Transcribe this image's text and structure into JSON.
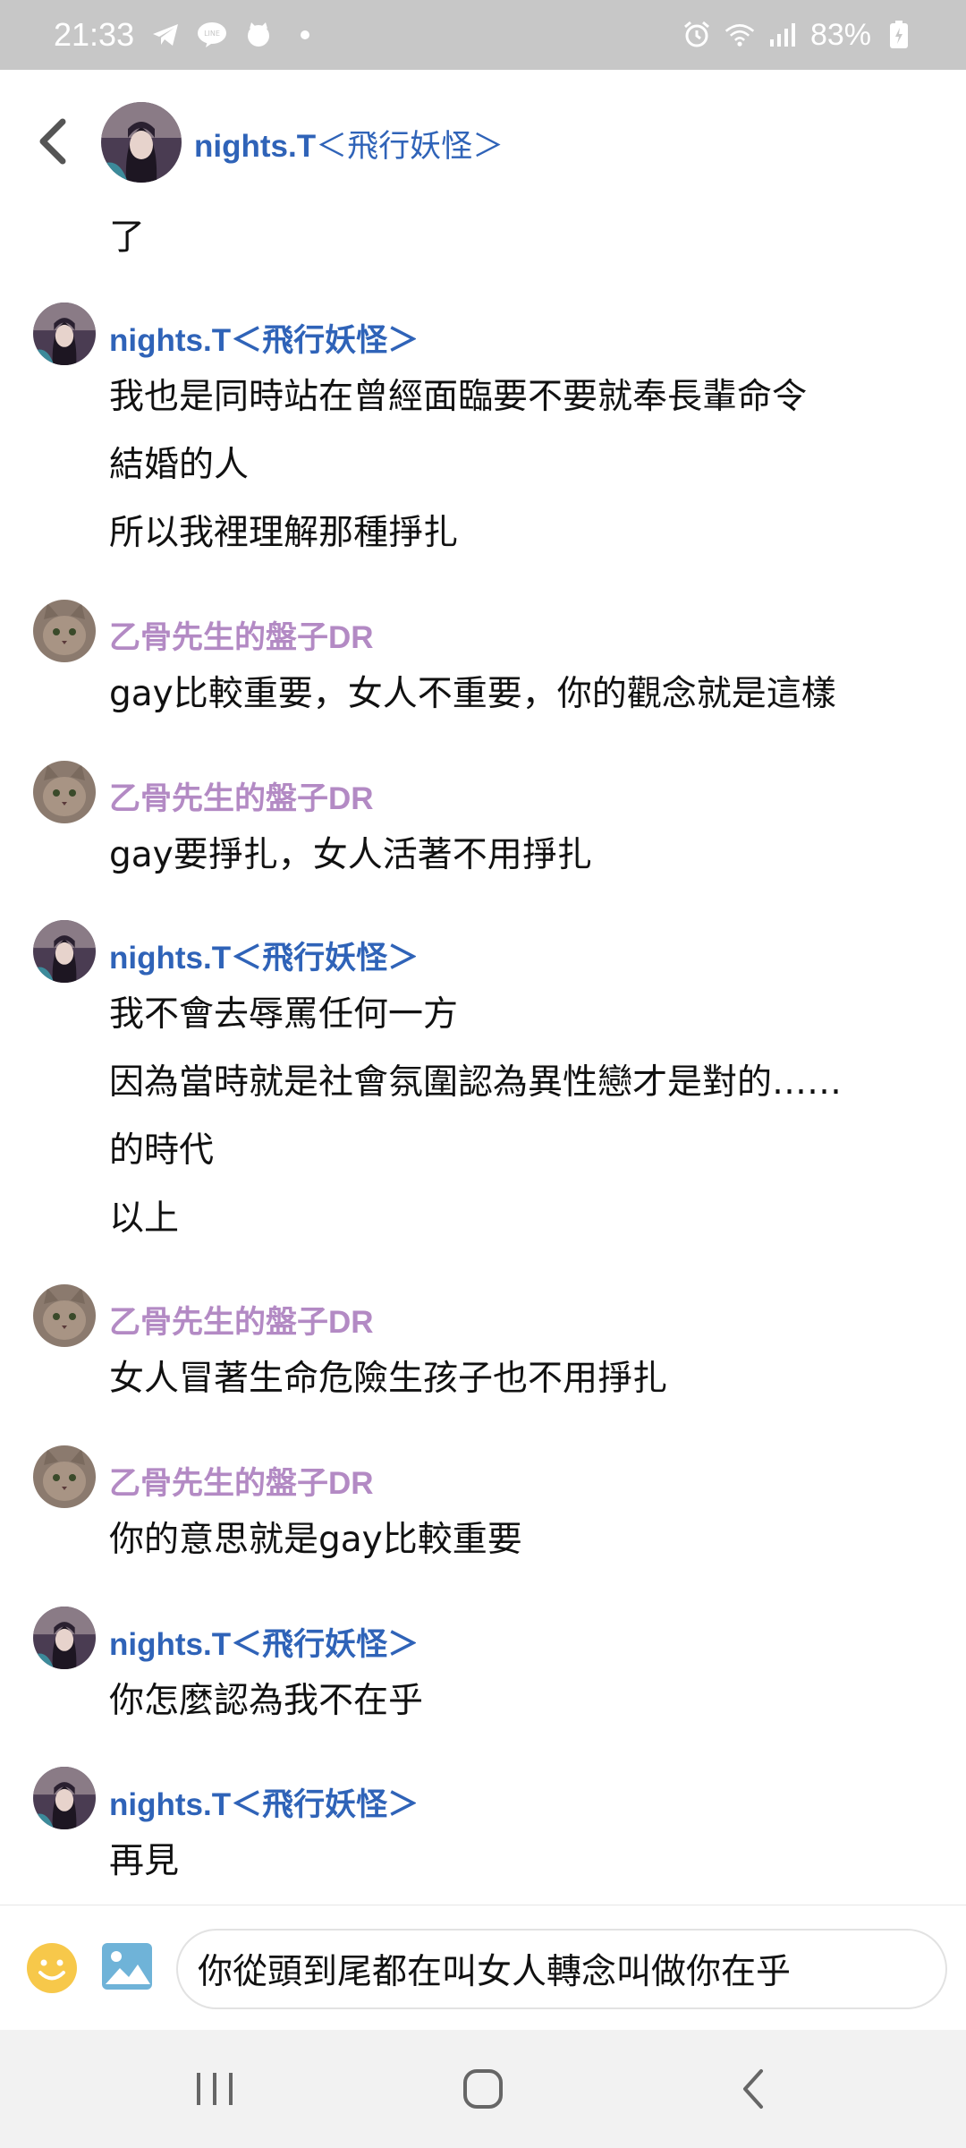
{
  "status_bar": {
    "time": "21:33",
    "battery": "83%",
    "left_icons": [
      "telegram-icon",
      "line-icon",
      "cat-app-icon",
      "dot-icon"
    ],
    "right_icons": [
      "alarm-icon",
      "wifi-icon",
      "signal-icon",
      "battery-icon"
    ]
  },
  "header": {
    "name_main": "nights.T",
    "name_bracket": "＜飛行妖怪＞"
  },
  "first_line": "了",
  "messages": [
    {
      "sender": "nights.T＜飛行妖怪＞",
      "lines": [
        "我也是同時站在曾經面臨要不要就奉長輩命令",
        "結婚的人",
        "所以我裡理解那種掙扎"
      ]
    },
    {
      "sender": "乙骨先生的盤子DR",
      "lines": [
        "gay比較重要，女人不重要，你的觀念就是這樣"
      ]
    },
    {
      "sender": "乙骨先生的盤子DR",
      "lines": [
        "gay要掙扎，女人活著不用掙扎"
      ]
    },
    {
      "sender": "nights.T＜飛行妖怪＞",
      "lines": [
        "我不會去辱罵任何一方",
        "因為當時就是社會氛圍認為異性戀才是對的……",
        "的時代",
        "以上"
      ]
    },
    {
      "sender": "乙骨先生的盤子DR",
      "lines": [
        "女人冒著生命危險生孩子也不用掙扎"
      ]
    },
    {
      "sender": "乙骨先生的盤子DR",
      "lines": [
        "你的意思就是gay比較重要"
      ]
    },
    {
      "sender": "nights.T＜飛行妖怪＞",
      "lines": [
        "你怎麼認為我不在乎"
      ]
    },
    {
      "sender": "nights.T＜飛行妖怪＞",
      "lines": [
        "再見"
      ]
    }
  ],
  "input": {
    "value": "你從頭到尾都在叫女人轉念叫做你在乎"
  },
  "colors": {
    "sender_blue": "#2f63b8",
    "sender_purple": "#b38ac4",
    "status_bar_bg": "#c7c7c7"
  }
}
